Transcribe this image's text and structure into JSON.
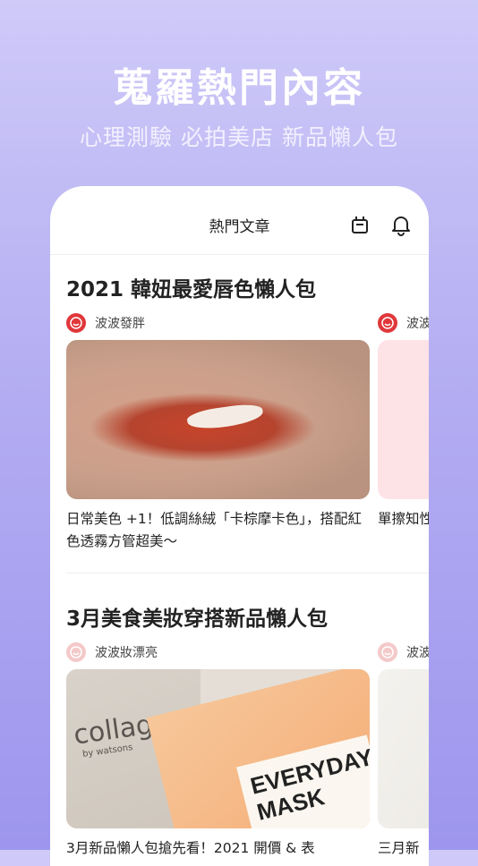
{
  "hero": {
    "title": "蒐羅熱門內容",
    "subtitle": "心理測驗 必拍美店 新品懶人包"
  },
  "app": {
    "header_title": "熱門文章",
    "icons": [
      "gift-box-icon",
      "bell-icon"
    ]
  },
  "sections": [
    {
      "title": "2021 韓妞最愛唇色懶人包",
      "cards": [
        {
          "author": "波波發胖",
          "caption": "日常美色 +1！低調絲絨「卡棕摩卡色」，搭配紅色透霧方管超美～",
          "image": "lips-photo"
        },
        {
          "author": "波波",
          "caption": "單擦知性裸奶茶色",
          "image": "pink-photo"
        }
      ]
    },
    {
      "title": "3月美食美妝穿搭新品懶人包",
      "cards": [
        {
          "author": "波波妝漂亮",
          "caption": "3月新品懶人包搶先看！2021 開價 & 表",
          "image": "face-mask-photo",
          "brand_text": "collagen",
          "brand_sub": "by watsons",
          "mask_text": "EVERYDAY MASK"
        },
        {
          "author": "波波",
          "caption": "三月新",
          "image": "fabric-photo"
        }
      ]
    }
  ],
  "colors": {
    "accent": "#e0373b",
    "background_top": "#cfcaf8",
    "background_bottom": "#9d96ee"
  }
}
